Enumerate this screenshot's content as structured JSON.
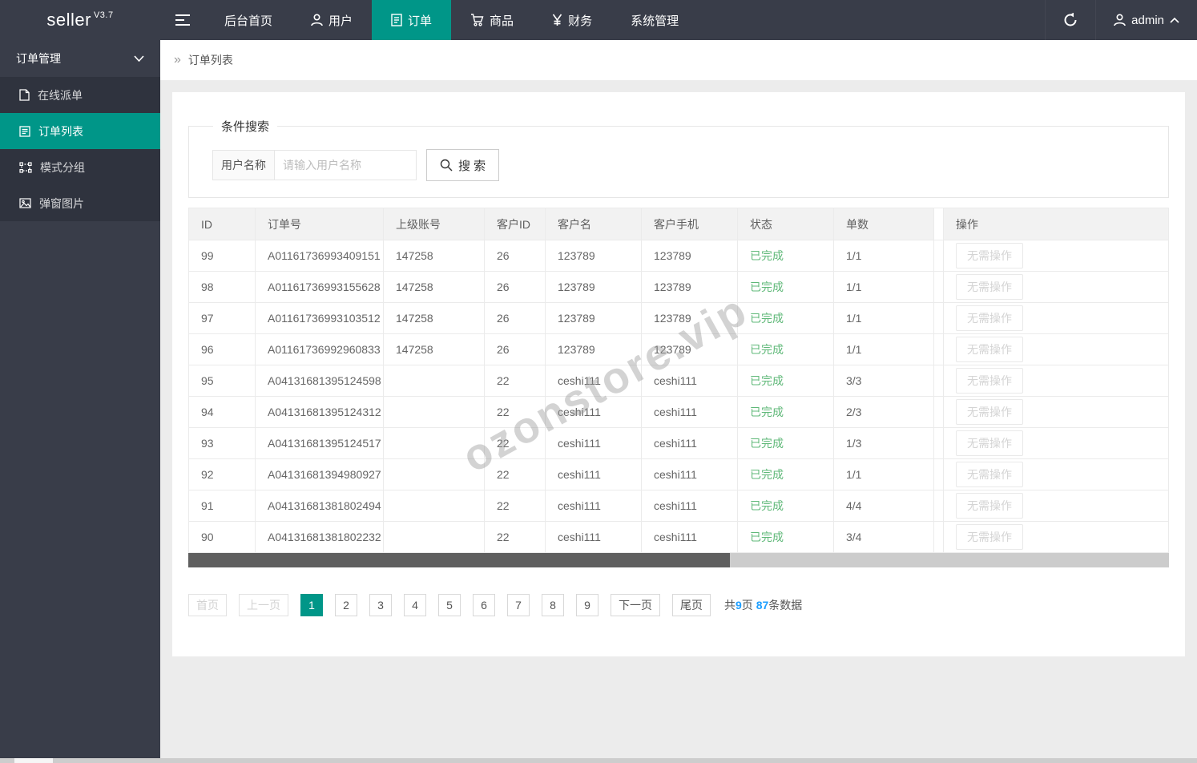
{
  "app": {
    "logo": "seller",
    "version": "V3.7"
  },
  "navbar": {
    "items": [
      {
        "label": "后台首页",
        "icon": null,
        "active": false
      },
      {
        "label": "用户",
        "icon": "user-icon",
        "active": false
      },
      {
        "label": "订单",
        "icon": "document-icon",
        "active": true
      },
      {
        "label": "商品",
        "icon": "cart-icon",
        "active": false
      },
      {
        "label": "财务",
        "icon": "yen-icon",
        "active": false
      },
      {
        "label": "系统管理",
        "icon": null,
        "active": false
      }
    ],
    "user": "admin"
  },
  "sidebar": {
    "group_label": "订单管理",
    "items": [
      {
        "label": "在线派单",
        "icon": "file-icon",
        "active": false
      },
      {
        "label": "订单列表",
        "icon": "list-icon",
        "active": true
      },
      {
        "label": "模式分组",
        "icon": "group-icon",
        "active": false
      },
      {
        "label": "弹窗图片",
        "icon": "image-icon",
        "active": false
      }
    ]
  },
  "breadcrumb": {
    "caret": "»",
    "current": "订单列表"
  },
  "search": {
    "legend": "条件搜索",
    "label": "用户名称",
    "placeholder": "请输入用户名称",
    "button_label": "搜 索"
  },
  "table": {
    "columns": [
      "ID",
      "订单号",
      "上级账号",
      "客户ID",
      "客户名",
      "客户手机",
      "状态",
      "单数",
      "操作"
    ],
    "rows": [
      {
        "id": "99",
        "order_no": "A01161736993409151",
        "parent_account": "147258",
        "customer_id": "26",
        "customer_name": "123789",
        "customer_phone": "123789",
        "status": "已完成",
        "count": "1/1",
        "action": "无需操作"
      },
      {
        "id": "98",
        "order_no": "A01161736993155628",
        "parent_account": "147258",
        "customer_id": "26",
        "customer_name": "123789",
        "customer_phone": "123789",
        "status": "已完成",
        "count": "1/1",
        "action": "无需操作"
      },
      {
        "id": "97",
        "order_no": "A01161736993103512",
        "parent_account": "147258",
        "customer_id": "26",
        "customer_name": "123789",
        "customer_phone": "123789",
        "status": "已完成",
        "count": "1/1",
        "action": "无需操作"
      },
      {
        "id": "96",
        "order_no": "A01161736992960833",
        "parent_account": "147258",
        "customer_id": "26",
        "customer_name": "123789",
        "customer_phone": "123789",
        "status": "已完成",
        "count": "1/1",
        "action": "无需操作"
      },
      {
        "id": "95",
        "order_no": "A04131681395124598",
        "parent_account": "",
        "customer_id": "22",
        "customer_name": "ceshi111",
        "customer_phone": "ceshi111",
        "status": "已完成",
        "count": "3/3",
        "action": "无需操作"
      },
      {
        "id": "94",
        "order_no": "A04131681395124312",
        "parent_account": "",
        "customer_id": "22",
        "customer_name": "ceshi111",
        "customer_phone": "ceshi111",
        "status": "已完成",
        "count": "2/3",
        "action": "无需操作"
      },
      {
        "id": "93",
        "order_no": "A04131681395124517",
        "parent_account": "",
        "customer_id": "22",
        "customer_name": "ceshi111",
        "customer_phone": "ceshi111",
        "status": "已完成",
        "count": "1/3",
        "action": "无需操作"
      },
      {
        "id": "92",
        "order_no": "A04131681394980927",
        "parent_account": "",
        "customer_id": "22",
        "customer_name": "ceshi111",
        "customer_phone": "ceshi111",
        "status": "已完成",
        "count": "1/1",
        "action": "无需操作"
      },
      {
        "id": "91",
        "order_no": "A04131681381802494",
        "parent_account": "",
        "customer_id": "22",
        "customer_name": "ceshi111",
        "customer_phone": "ceshi111",
        "status": "已完成",
        "count": "4/4",
        "action": "无需操作"
      },
      {
        "id": "90",
        "order_no": "A04131681381802232",
        "parent_account": "",
        "customer_id": "22",
        "customer_name": "ceshi111",
        "customer_phone": "ceshi111",
        "status": "已完成",
        "count": "3/4",
        "action": "无需操作"
      }
    ]
  },
  "pagination": {
    "first": "首页",
    "prev": "上一页",
    "pages": [
      "1",
      "2",
      "3",
      "4",
      "5",
      "6",
      "7",
      "8",
      "9"
    ],
    "current": "1",
    "next": "下一页",
    "last": "尾页",
    "summary": {
      "prefix": "共",
      "total_pages": "9",
      "pages_unit": "页",
      "total_records": "87",
      "records_unit": "条数据"
    }
  },
  "watermark": "ozonstore.vip",
  "colors": {
    "navbar_bg": "#393D49",
    "submenu_bg": "#2F333E",
    "accent_teal": "#009688",
    "status_green": "#5FB878",
    "link_blue": "#1E9FFF"
  }
}
